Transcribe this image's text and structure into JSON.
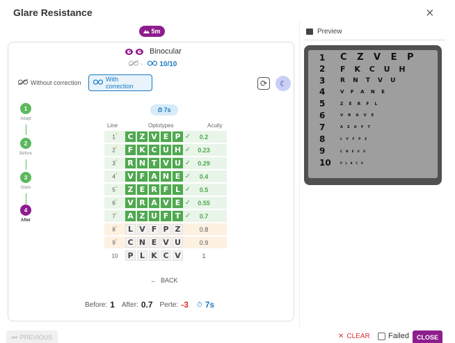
{
  "header": {
    "title": "Glare Resistance",
    "close_icon": "×"
  },
  "test": {
    "distance": "5m",
    "distance_icon": "mountain-icon",
    "mode_label": "Binocular",
    "uncorrected_value": "-",
    "corrected_value": "10/10"
  },
  "correction_tabs": [
    {
      "label": "Without correction",
      "active": false
    },
    {
      "label": "With correction",
      "active": true
    }
  ],
  "stepper": [
    {
      "number": "1",
      "label": "Adapt",
      "state": "done"
    },
    {
      "number": "2",
      "label": "Before",
      "state": "done"
    },
    {
      "number": "3",
      "label": "Glare",
      "state": "done"
    },
    {
      "number": "4",
      "label": "After",
      "state": "active"
    }
  ],
  "timer": "7s",
  "chart": {
    "col_line": "Line",
    "col_optotypes": "Optotypes",
    "col_acuity": "Acuity",
    "rows": [
      {
        "line": "1",
        "star": "*",
        "letters": [
          "C",
          "Z",
          "V",
          "E",
          "P"
        ],
        "check": "✓",
        "acuity": "0.2",
        "status": "green"
      },
      {
        "line": "2",
        "star": "*",
        "letters": [
          "F",
          "K",
          "C",
          "U",
          "H"
        ],
        "check": "✓",
        "acuity": "0.23",
        "status": "green"
      },
      {
        "line": "3",
        "star": "*",
        "letters": [
          "R",
          "N",
          "T",
          "V",
          "U"
        ],
        "check": "✓",
        "acuity": "0.29",
        "status": "green"
      },
      {
        "line": "4",
        "star": "*",
        "letters": [
          "V",
          "F",
          "A",
          "N",
          "E"
        ],
        "check": "✓",
        "acuity": "0.4",
        "status": "green"
      },
      {
        "line": "5",
        "star": "*",
        "letters": [
          "Z",
          "E",
          "R",
          "F",
          "L"
        ],
        "check": "✓",
        "acuity": "0.5",
        "status": "green"
      },
      {
        "line": "6",
        "star": "*",
        "letters": [
          "V",
          "R",
          "A",
          "V",
          "E"
        ],
        "check": "✓",
        "acuity": "0.55",
        "status": "green"
      },
      {
        "line": "7",
        "star": "*",
        "letters": [
          "A",
          "Z",
          "U",
          "F",
          "T"
        ],
        "check": "✓",
        "acuity": "0.7",
        "status": "green"
      },
      {
        "line": "8",
        "star": "*",
        "letters": [
          "L",
          "V",
          "F",
          "P",
          "Z"
        ],
        "check": "",
        "acuity": "0.8",
        "status": "orange"
      },
      {
        "line": "9",
        "star": "*",
        "letters": [
          "C",
          "N",
          "E",
          "V",
          "U"
        ],
        "check": "",
        "acuity": "0.9",
        "status": "orange"
      },
      {
        "line": "10",
        "star": "",
        "letters": [
          "P",
          "L",
          "K",
          "C",
          "V"
        ],
        "check": "",
        "acuity": "1",
        "status": "plain"
      }
    ]
  },
  "back_label": "BACK",
  "summary": {
    "before_label": "Before:",
    "before_value": "1",
    "after_label": "After:",
    "after_value": "0.7",
    "loss_label": "Perte:",
    "loss_value": "-3",
    "time_value": "7s"
  },
  "preview": {
    "title": "Preview",
    "rows": [
      {
        "num": "1",
        "letters": "C Z V E P"
      },
      {
        "num": "2",
        "letters": "F K C U H"
      },
      {
        "num": "3",
        "letters": "R N T V U"
      },
      {
        "num": "4",
        "letters": "V F A N E"
      },
      {
        "num": "5",
        "letters": "Z E R F L"
      },
      {
        "num": "6",
        "letters": "V R A V E"
      },
      {
        "num": "7",
        "letters": "A Z U F T"
      },
      {
        "num": "8",
        "letters": "L V F P Z"
      },
      {
        "num": "9",
        "letters": "C N E V U"
      },
      {
        "num": "10",
        "letters": "P L K C V"
      }
    ]
  },
  "footer": {
    "previous_label": "PREVIOUS",
    "clear_label": "CLEAR",
    "failed_label": "Failed",
    "close_label": "CLOSE"
  },
  "colors": {
    "brand": "#8e1d8e",
    "accent_blue": "#1a78c2",
    "pass_green": "#4fa84f",
    "fail_red": "#e03030"
  }
}
